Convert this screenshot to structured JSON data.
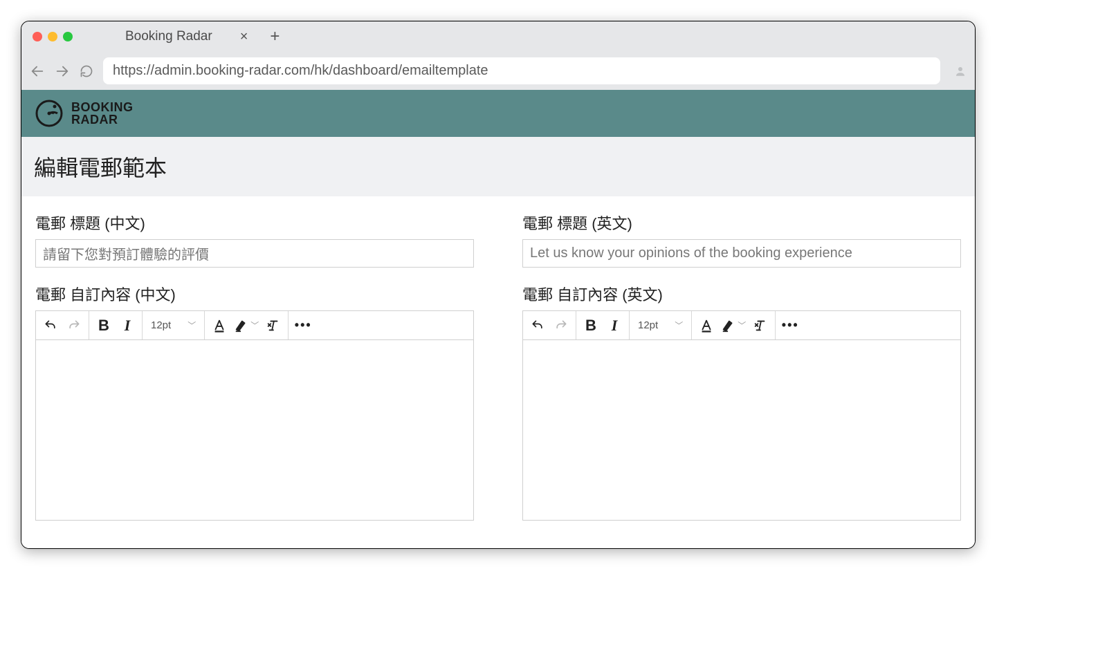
{
  "browser": {
    "tab_title": "Booking Radar",
    "url": "https://admin.booking-radar.com/hk/dashboard/emailtemplate"
  },
  "brand": {
    "name_line1": "BOOKING",
    "name_line2": "RADAR",
    "header_bg": "#5a8a8a"
  },
  "page": {
    "title": "編輯電郵範本"
  },
  "form": {
    "zh": {
      "title_label": "電郵 標題 (中文)",
      "title_value": "請留下您對預訂體驗的評價",
      "content_label": "電郵 自訂內容 (中文)",
      "content_value": ""
    },
    "en": {
      "title_label": "電郵 標題 (英文)",
      "title_value": "Let us know your opinions of the booking experience",
      "content_label": "電郵 自訂內容 (英文)",
      "content_value": ""
    }
  },
  "editor_toolbar": {
    "font_size": "12pt",
    "bold_label": "B",
    "italic_label": "I",
    "clear_format_label": "I",
    "more": "•••"
  }
}
